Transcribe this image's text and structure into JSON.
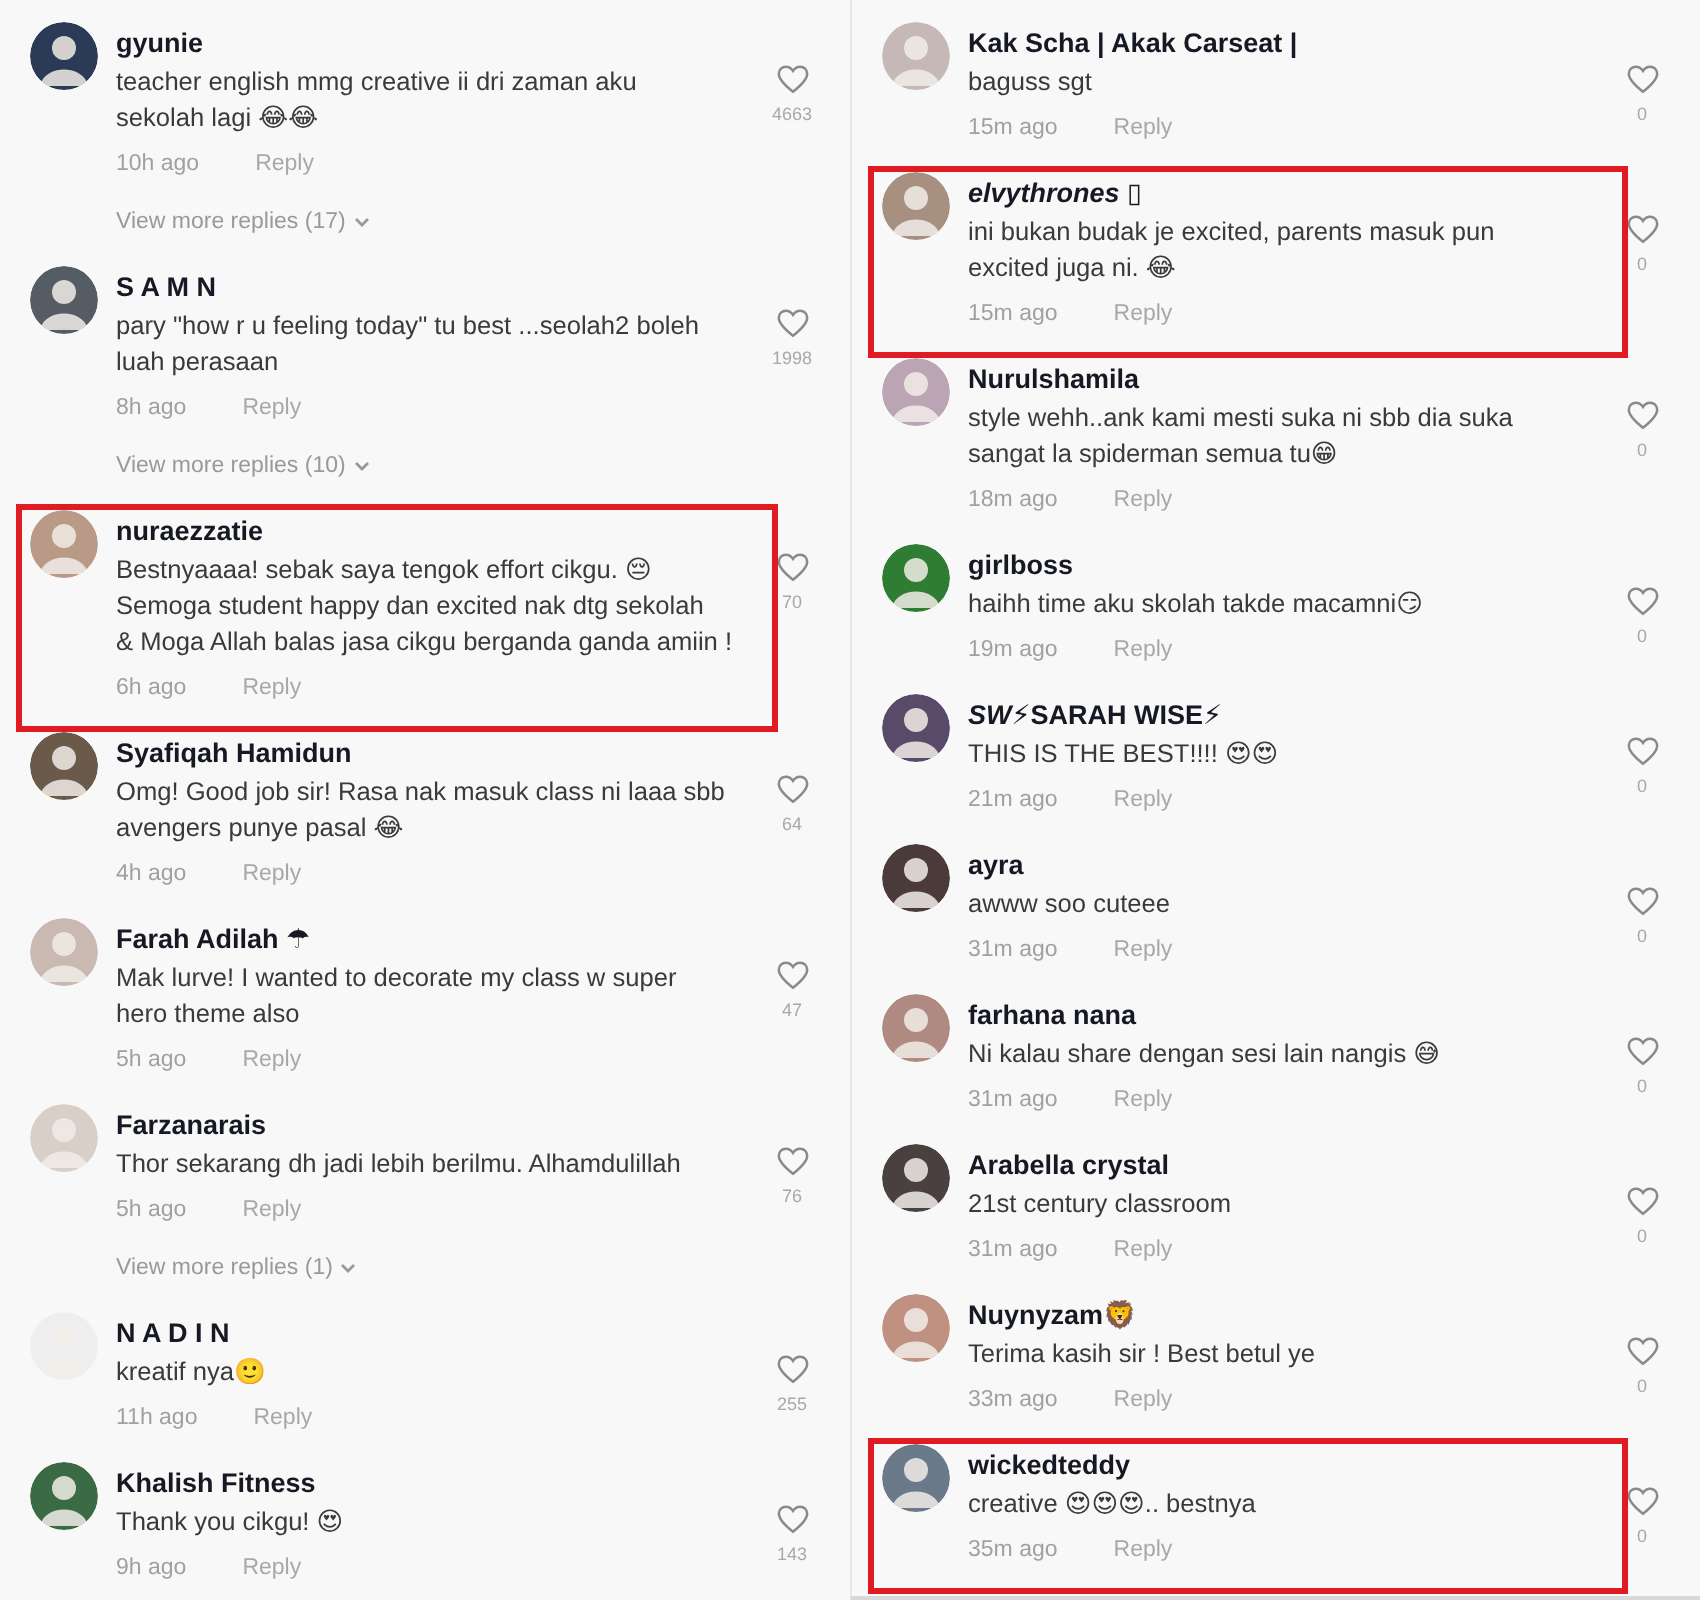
{
  "columns": [
    {
      "comments": [
        {
          "name": "gyunie",
          "text": "teacher english mmg creative ii dri zaman aku\nsekolah lagi 😂😂",
          "time": "10h ago",
          "reply": "Reply",
          "likes": "4663",
          "more_replies": "View more replies (17)",
          "highlighted": false
        },
        {
          "name": "S A M N",
          "text": "pary \"how r u feeling today\" tu best ...seolah2 boleh\nluah perasaan",
          "time": "8h ago",
          "reply": "Reply",
          "likes": "1998",
          "more_replies": "View more replies (10)",
          "highlighted": false
        },
        {
          "name": "nuraezzatie",
          "text": "Bestnyaaaa! sebak saya tengok effort cikgu. 😔\nSemoga student happy dan excited nak dtg sekolah\n& Moga Allah balas jasa cikgu berganda ganda amiin !",
          "time": "6h ago",
          "reply": "Reply",
          "likes": "70",
          "highlighted": true
        },
        {
          "name": "Syafiqah Hamidun",
          "text": "Omg! Good job sir! Rasa nak masuk class ni laaa sbb\navengers punye pasal 😂",
          "time": "4h ago",
          "reply": "Reply",
          "likes": "64",
          "highlighted": false
        },
        {
          "name": "Farah Adilah ☂",
          "text": "Mak lurve! I wanted to decorate my class w super\nhero theme also",
          "time": "5h ago",
          "reply": "Reply",
          "likes": "47",
          "highlighted": false
        },
        {
          "name": "Farzanarais",
          "text": "Thor sekarang dh jadi lebih berilmu. Alhamdulillah",
          "time": "5h ago",
          "reply": "Reply",
          "likes": "76",
          "more_replies": "View more replies (1)",
          "highlighted": false
        },
        {
          "name": "N A D I N",
          "text": "kreatif nya🙂",
          "time": "11h ago",
          "reply": "Reply",
          "likes": "255",
          "highlighted": false
        },
        {
          "name": "Khalish Fitness",
          "text": "Thank you cikgu! 😍",
          "time": "9h ago",
          "reply": "Reply",
          "likes": "143",
          "highlighted": false
        }
      ]
    },
    {
      "comments": [
        {
          "name": "Kak Scha | Akak Carseat |",
          "text": "baguss sgt",
          "time": "15m ago",
          "reply": "Reply",
          "likes": "0",
          "highlighted": false
        },
        {
          "name": "*elvythrones* ▯",
          "text": "ini bukan budak je excited, parents masuk pun\nexcited juga ni. 😂",
          "time": "15m ago",
          "reply": "Reply",
          "likes": "0",
          "highlighted": true
        },
        {
          "name": "Nurulshamila",
          "text": "style wehh..ank kami mesti suka ni sbb dia suka\nsangat la spiderman semua tu😁",
          "time": "18m ago",
          "reply": "Reply",
          "likes": "0",
          "highlighted": false
        },
        {
          "name": "girlboss",
          "text": "haihh time aku skolah takde macamni😏",
          "time": "19m ago",
          "reply": "Reply",
          "likes": "0",
          "highlighted": false
        },
        {
          "name": "*SW*⚡SARAH WISE⚡",
          "text": "THIS IS THE BEST!!!! 😍😍",
          "time": "21m ago",
          "reply": "Reply",
          "likes": "0",
          "highlighted": false
        },
        {
          "name": "ayra",
          "text": "awww soo cuteee",
          "time": "31m ago",
          "reply": "Reply",
          "likes": "0",
          "highlighted": false
        },
        {
          "name": "farhana nana",
          "text": "Ni kalau share dengan sesi lain nangis 😅",
          "time": "31m ago",
          "reply": "Reply",
          "likes": "0",
          "highlighted": false
        },
        {
          "name": "Arabella crystal",
          "text": "21st century classroom",
          "time": "31m ago",
          "reply": "Reply",
          "likes": "0",
          "highlighted": false
        },
        {
          "name": "Nuynyzam🦁",
          "text": "Terima kasih sir ! Best betul ye",
          "time": "33m ago",
          "reply": "Reply",
          "likes": "0",
          "highlighted": false
        },
        {
          "name": "wickedteddy",
          "text": "creative 😍😍😍.. bestnya",
          "time": "35m ago",
          "reply": "Reply",
          "likes": "0",
          "highlighted": true
        }
      ]
    }
  ]
}
